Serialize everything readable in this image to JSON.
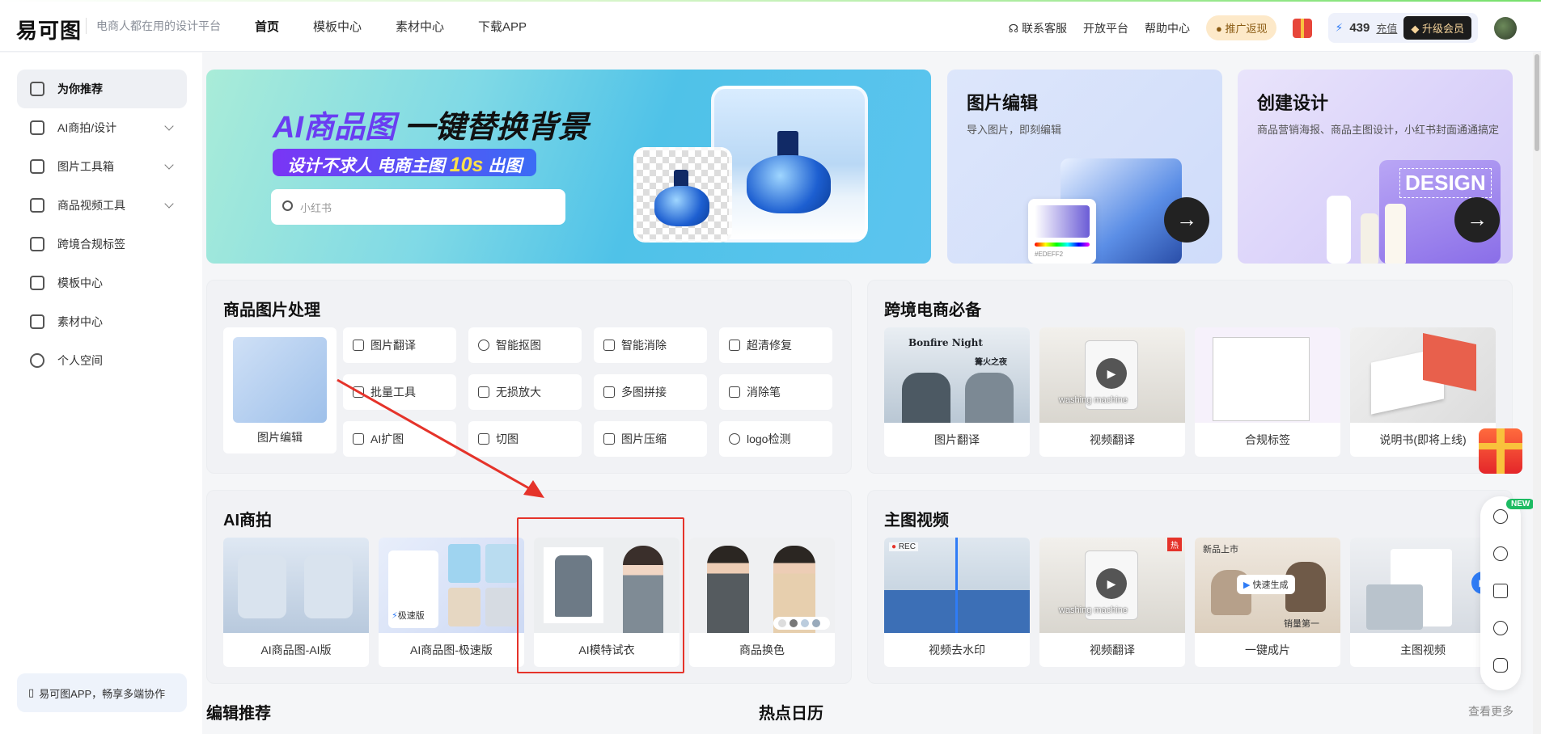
{
  "header": {
    "logo": "易可图",
    "slogan": "电商人都在用的设计平台",
    "nav": [
      "首页",
      "模板中心",
      "素材中心",
      "下载APP"
    ],
    "links": [
      "联系客服",
      "开放平台",
      "帮助中心"
    ],
    "promo": "推广返现",
    "coins": "439",
    "recharge": "充值",
    "upgrade": "升级会员"
  },
  "sidebar": {
    "items": [
      {
        "label": "为你推荐",
        "icon": "home-icon"
      },
      {
        "label": "AI商拍/设计",
        "icon": "ai-icon"
      },
      {
        "label": "图片工具箱",
        "icon": "toolbox-icon"
      },
      {
        "label": "商品视频工具",
        "icon": "video-icon"
      },
      {
        "label": "跨境合规标签",
        "icon": "tag-icon"
      },
      {
        "label": "模板中心",
        "icon": "template-icon"
      },
      {
        "label": "素材中心",
        "icon": "material-icon"
      },
      {
        "label": "个人空间",
        "icon": "user-icon"
      }
    ],
    "app_promo": "易可图APP，畅享多端协作"
  },
  "banner": {
    "title_highlight": "AI商品图",
    "title_rest": "一键替换背景",
    "sub_a": "设计不求人 电商主图",
    "sub_b": "10s",
    "sub_c": "出图",
    "search_placeholder": "小红书"
  },
  "cards": [
    {
      "title": "图片编辑",
      "desc": "导入图片，即刻编辑",
      "swatch": "#EDEFF2"
    },
    {
      "title": "创建设计",
      "desc": "商品营销海报、商品主图设计，小红书封面通通搞定",
      "badge": "DESIGN"
    }
  ],
  "product_panel": {
    "title": "商品图片处理",
    "feature": "图片编辑",
    "tools": [
      "图片翻译",
      "智能抠图",
      "智能消除",
      "超清修复",
      "批量工具",
      "无损放大",
      "多图拼接",
      "消除笔",
      "AI扩图",
      "切图",
      "图片压缩",
      "logo检测"
    ]
  },
  "crossborder_panel": {
    "title": "跨境电商必备",
    "tiles": [
      "图片翻译",
      "视频翻译",
      "合规标签",
      "说明书(即将上线)"
    ],
    "tile_text": [
      "Bonfire Night",
      "篝火之夜",
      "washing machine"
    ]
  },
  "ai_panel": {
    "title": "AI商拍",
    "tiles": [
      "AI商品图-AI版",
      "AI商品图-极速版",
      "AI模特试衣",
      "商品换色"
    ],
    "fast_badge": "极速版"
  },
  "video_panel": {
    "title": "主图视频",
    "tiles": [
      "视频去水印",
      "视频翻译",
      "一键成片",
      "主图视频"
    ],
    "rec": "REC",
    "hot": "热",
    "new_arrival": "新品上市",
    "quick_gen": "快速生成",
    "sales": "销量第一"
  },
  "bottom": {
    "left": "编辑推荐",
    "mid": "热点日历",
    "more": "查看更多"
  },
  "floatbar": {
    "new_badge": "NEW"
  }
}
